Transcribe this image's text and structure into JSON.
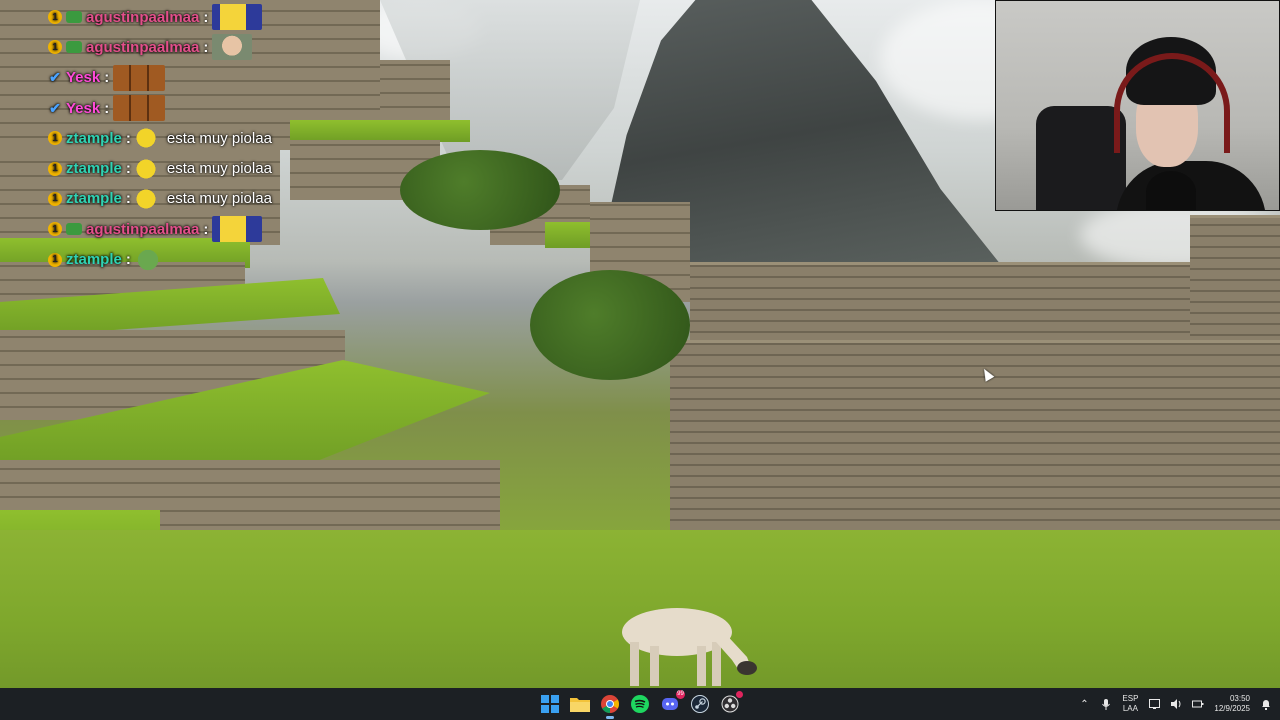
{
  "chat": {
    "messages": [
      {
        "username": "agustinpaalmaa",
        "color": "#e34f8b",
        "badges": [
          "gold",
          "green"
        ],
        "message": "",
        "emote": "minion"
      },
      {
        "username": "agustinpaalmaa",
        "color": "#e34f8b",
        "badges": [
          "gold",
          "green"
        ],
        "message": "",
        "emote": "face"
      },
      {
        "username": "Yesk",
        "color": "#ff4ad8",
        "badges": [
          "blue-check"
        ],
        "message": "",
        "emote": "monkeys"
      },
      {
        "username": "Yesk",
        "color": "#ff4ad8",
        "badges": [
          "blue-check"
        ],
        "message": "",
        "emote": "monkeys"
      },
      {
        "username": "ztample",
        "color": "#2fd3b3",
        "badges": [
          "gold"
        ],
        "message": "esta muy piolaa",
        "emote": "lemon"
      },
      {
        "username": "ztample",
        "color": "#2fd3b3",
        "badges": [
          "gold"
        ],
        "message": "esta muy piolaa",
        "emote": "lemon"
      },
      {
        "username": "ztample",
        "color": "#2fd3b3",
        "badges": [
          "gold"
        ],
        "message": "esta muy piolaa",
        "emote": "lemon"
      },
      {
        "username": "agustinpaalmaa",
        "color": "#e34f8b",
        "badges": [
          "gold",
          "green"
        ],
        "message": "",
        "emote": "minion"
      },
      {
        "username": "ztample",
        "color": "#2fd3b3",
        "badges": [
          "gold"
        ],
        "message": "",
        "emote": "pepe"
      }
    ],
    "separator": ":"
  },
  "taskbar": {
    "apps": [
      {
        "name": "start",
        "icon": "windows-icon",
        "active": false
      },
      {
        "name": "file-explorer",
        "icon": "folder-icon",
        "active": false
      },
      {
        "name": "chrome",
        "icon": "chrome-icon",
        "active": true
      },
      {
        "name": "spotify",
        "icon": "spotify-icon",
        "active": false
      },
      {
        "name": "discord",
        "icon": "discord-icon",
        "active": false,
        "badge": "99"
      },
      {
        "name": "steam",
        "icon": "steam-icon",
        "active": false
      },
      {
        "name": "obs",
        "icon": "obs-icon",
        "active": false,
        "badge": ""
      }
    ],
    "tray": {
      "lang_top": "ESP",
      "lang_bottom": "LAA",
      "time": "03:50",
      "date": "12/9/2025"
    }
  },
  "colors": {
    "taskbar_bg": "#1c2024",
    "accent": "#7fb8f0"
  }
}
